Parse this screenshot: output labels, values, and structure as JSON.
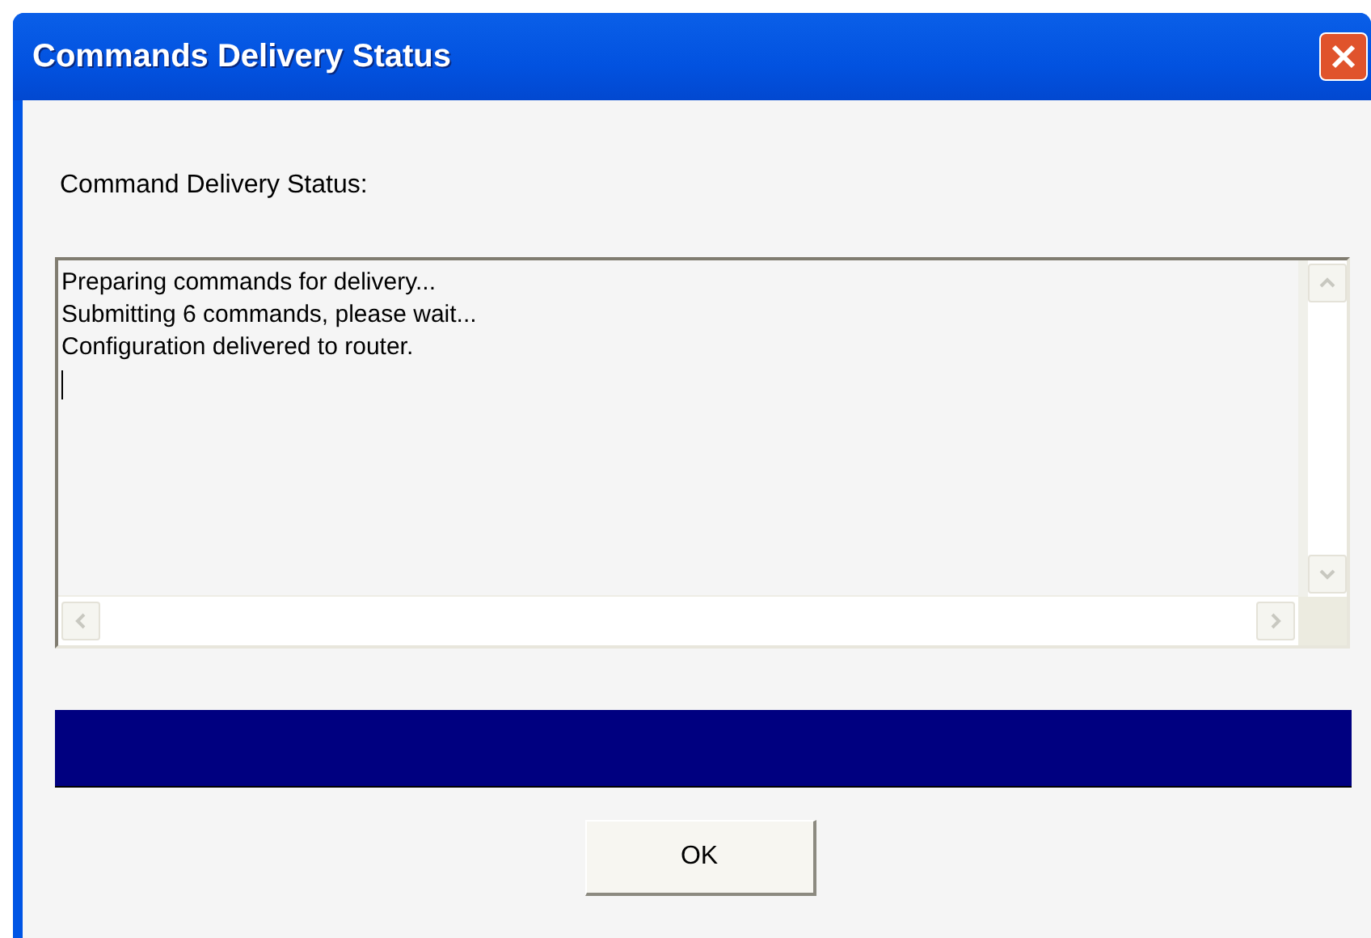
{
  "window": {
    "title": "Commands Delivery Status"
  },
  "status_label": "Command Delivery Status:",
  "log": {
    "lines": [
      "Preparing commands for delivery...",
      "Submitting 6 commands, please wait...",
      "Configuration delivered to router."
    ]
  },
  "progress": {
    "level": 1
  },
  "buttons": [
    {
      "label": "OK"
    }
  ]
}
